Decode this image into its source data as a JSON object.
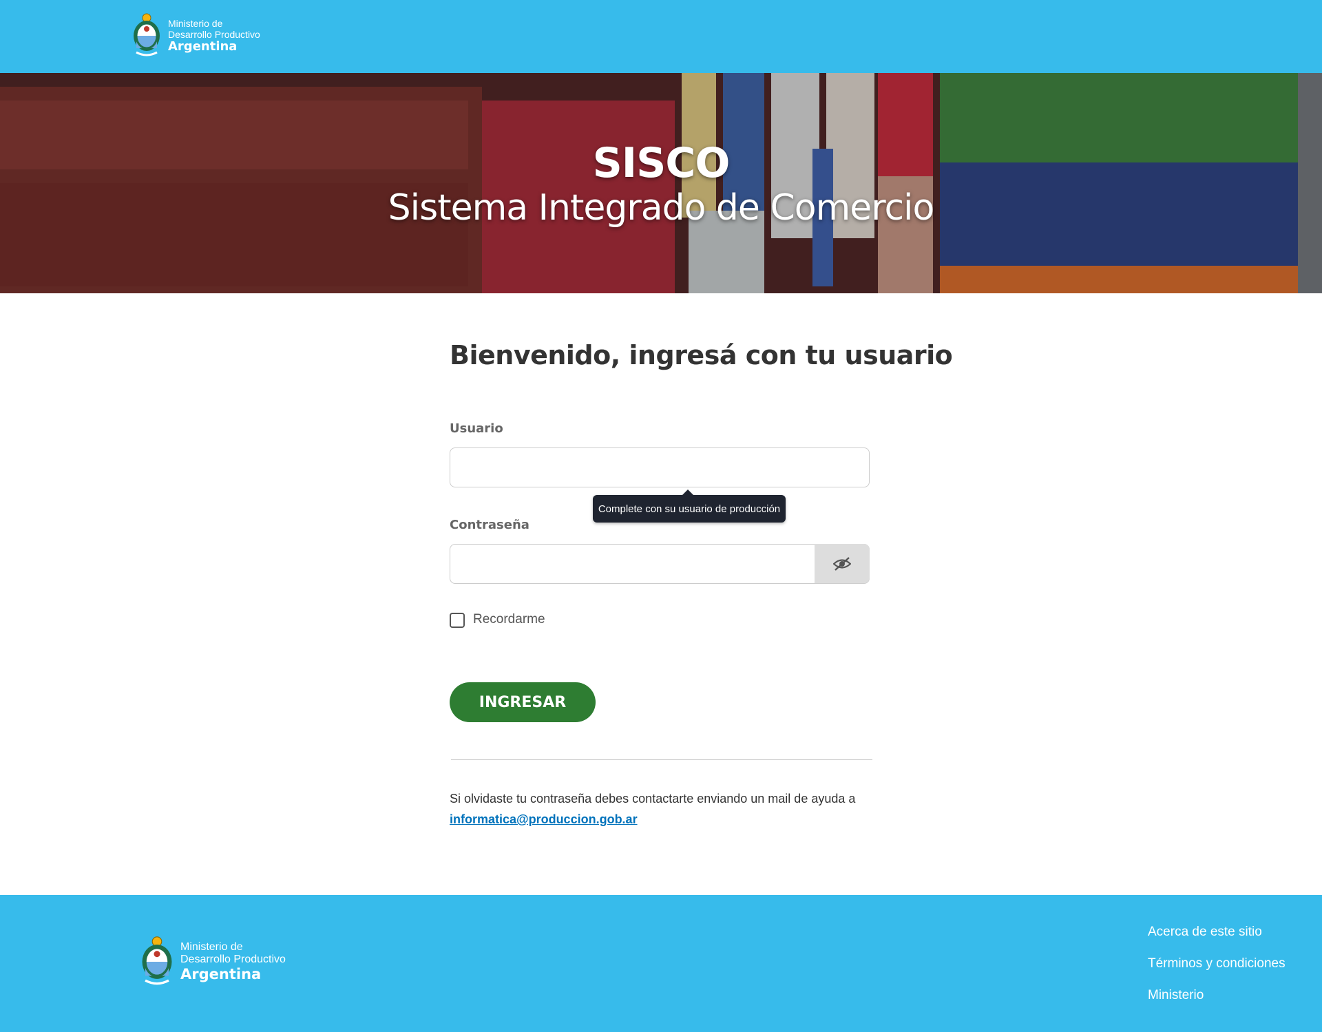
{
  "header": {
    "org_line1": "Ministerio de",
    "org_line2": "Desarrollo Productivo",
    "org_line3": "Argentina"
  },
  "hero": {
    "title": "SISCO",
    "subtitle": "Sistema Integrado de Comercio"
  },
  "form": {
    "heading": "Bienvenido, ingresá con tu usuario",
    "user_label": "Usuario",
    "user_value": "",
    "user_tooltip": "Complete con su usuario de producción",
    "password_label": "Contraseña",
    "password_value": "",
    "toggle_visibility_icon": "eye-slash-icon",
    "remember_label": "Recordarme",
    "remember_checked": false,
    "submit_label": "INGRESAR",
    "submit_color": "#2E7D32",
    "help_text": "Si olvidaste tu contraseña debes contactarte enviando un mail de ayuda a ",
    "help_email": "informatica@produccion.gob.ar"
  },
  "footer": {
    "org_line1": "Ministerio de",
    "org_line2": "Desarrollo Productivo",
    "org_line3": "Argentina",
    "links": [
      "Acerca de este sitio",
      "Términos y condiciones",
      "Ministerio"
    ]
  },
  "colors": {
    "brand_blue": "#37BBEB",
    "link_blue": "#0072BB",
    "tooltip_bg": "#1f2430"
  }
}
